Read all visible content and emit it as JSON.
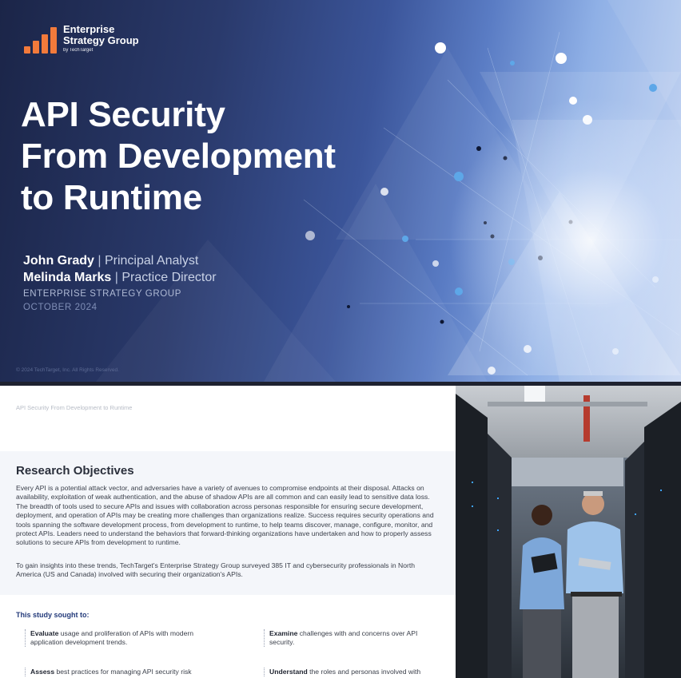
{
  "cover": {
    "logo": {
      "line1": "Enterprise",
      "line2": "Strategy Group",
      "tagline": "by TechTarget",
      "color": "#f27a3b"
    },
    "title_lines": [
      "API Security",
      "From Development",
      "to Runtime"
    ],
    "authors": [
      {
        "name": "John Grady",
        "separator": "|",
        "role": "Principal Analyst"
      },
      {
        "name": "Melinda Marks",
        "separator": "|",
        "role": "Practice Director"
      }
    ],
    "organization": "ENTERPRISE STRATEGY GROUP",
    "date": "OCTOBER 2024",
    "copyright": "© 2024 TechTarget, Inc. All Rights Reserved."
  },
  "page": {
    "running_header": "API Security From Development to Runtime",
    "section_title": "Research Objectives",
    "paragraph1": "Every API is a potential attack vector, and adversaries have a variety of avenues to compromise endpoints at their disposal. Attacks on availability, exploitation of weak authentication, and the abuse of shadow APIs are all common and can easily lead to sensitive data loss. The breadth of tools used to secure APIs and issues with collaboration across personas responsible for ensuring secure development, deployment, and operation of APIs may be creating more challenges than organizations realize. Success requires security operations and tools spanning the software development process, from development to runtime, to help teams discover, manage, configure, monitor, and protect APIs. Leaders need to understand the behaviors that forward-thinking organizations have undertaken and how to properly assess solutions to secure APIs from development to runtime.",
    "paragraph2": "To gain insights into these trends, TechTarget's Enterprise Strategy Group surveyed 385 IT and cybersecurity professionals in North America  (US and Canada) involved with securing their organization's APIs.",
    "sought_heading": "This study sought to:",
    "bullets": [
      {
        "verb": "Evaluate",
        "text": " usage and proliferation of APIs with modern application development trends."
      },
      {
        "verb": "Examine",
        "text": " challenges with and concerns over API security."
      },
      {
        "verb": "Assess",
        "text": " best practices for managing API security risk"
      },
      {
        "verb": "Understand",
        "text": " the roles and personas involved with"
      }
    ]
  }
}
